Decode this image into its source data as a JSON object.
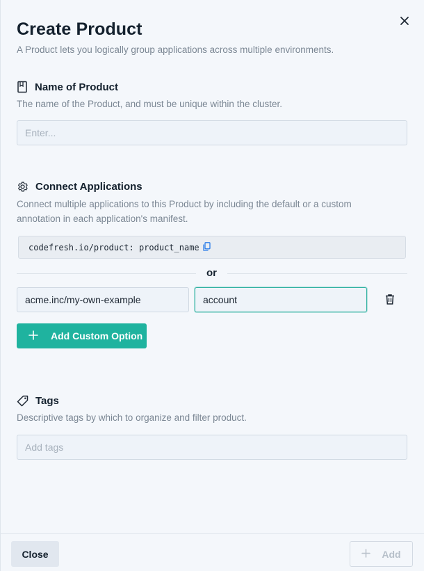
{
  "dialog": {
    "title": "Create Product",
    "subtitle": "A Product lets you logically group applications across multiple environments."
  },
  "name_section": {
    "heading": "Name of Product",
    "description": "The name of the Product, and must be unique within the cluster.",
    "input_placeholder": "Enter..."
  },
  "connect_section": {
    "heading": "Connect Applications",
    "description": "Connect multiple applications to this Product by including the default or a custom annotation in each application's manifest.",
    "default_annotation": "codefresh.io/product: product_name",
    "or_label": "or",
    "custom_key_value": "acme.inc/my-own-example",
    "custom_value_value": "account",
    "add_custom_label": "Add Custom Option"
  },
  "tags_section": {
    "heading": "Tags",
    "description": "Descriptive tags by which to organize and filter product.",
    "input_placeholder": "Add tags"
  },
  "footer": {
    "close_label": "Close",
    "add_label": "Add"
  },
  "colors": {
    "accent": "#1fb39f",
    "focus_border": "#30b2a2",
    "link_blue": "#2b7de9"
  },
  "icons": [
    "close-icon",
    "bookmark-icon",
    "gear-icon",
    "copy-icon",
    "trash-icon",
    "plus-icon",
    "tag-icon"
  ]
}
